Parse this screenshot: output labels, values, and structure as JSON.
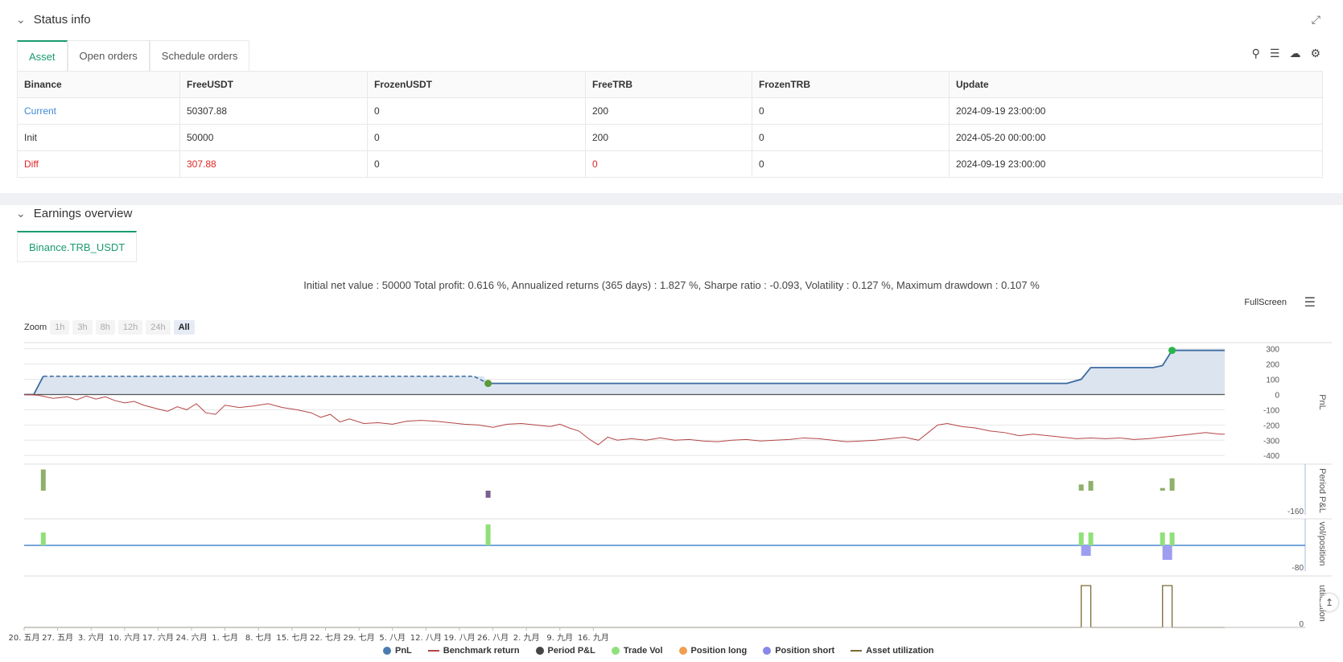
{
  "status": {
    "title": "Status info",
    "tabs": [
      {
        "label": "Asset",
        "active": true
      },
      {
        "label": "Open orders",
        "active": false
      },
      {
        "label": "Schedule orders",
        "active": false
      }
    ],
    "table": {
      "headers": [
        "Binance",
        "FreeUSDT",
        "FrozenUSDT",
        "FreeTRB",
        "FrozenTRB",
        "Update"
      ],
      "rows": [
        [
          "Current",
          "50307.88",
          "0",
          "200",
          "0",
          "2024-09-19 23:00:00"
        ],
        [
          "Init",
          "50000",
          "0",
          "200",
          "0",
          "2024-05-20 00:00:00"
        ],
        [
          "Diff",
          "307.88",
          "0",
          "0",
          "0",
          "2024-09-19 23:00:00"
        ]
      ]
    }
  },
  "earnings": {
    "title": "Earnings overview",
    "tab": "Binance.TRB_USDT",
    "summary": "Initial net value : 50000 Total profit: 0.616 %, Annualized returns (365 days) : 1.827 %, Sharpe ratio : -0.093, Volatility : 0.127 %, Maximum drawdown : 0.107 %",
    "fullscreen_label": "FullScreen",
    "zoom_label": "Zoom",
    "zoom_options": [
      "1h",
      "3h",
      "8h",
      "12h",
      "24h",
      "All"
    ],
    "zoom_selected": "All"
  },
  "chart_data": {
    "type": "line",
    "x_ticks": [
      "20. 五月",
      "27. 五月",
      "3. 六月",
      "10. 六月",
      "17. 六月",
      "24. 六月",
      "1. 七月",
      "8. 七月",
      "15. 七月",
      "22. 七月",
      "29. 七月",
      "5. 八月",
      "12. 八月",
      "19. 八月",
      "26. 八月",
      "2. 九月",
      "9. 九月",
      "16. 九月"
    ],
    "pnl_axis_ticks": [
      "300",
      "200",
      "100",
      "0",
      "-100",
      "-200",
      "-300",
      "-400"
    ],
    "pnl_axis_label": "PnL",
    "period_axis_label": "Period P&L",
    "period_axis_tick": "-160",
    "vol_axis_label": "vol/position",
    "vol_axis_tick": "-80",
    "util_axis_label": "utilization",
    "util_axis_tick": "0",
    "pnl_ylim": [
      -420,
      330
    ],
    "pnl": [
      [
        0,
        0
      ],
      [
        2,
        0
      ],
      [
        4,
        120
      ],
      [
        96,
        120
      ],
      [
        97,
        73
      ],
      [
        218,
        73
      ],
      [
        221,
        100
      ],
      [
        223,
        177
      ],
      [
        236,
        177
      ],
      [
        238,
        190
      ],
      [
        240,
        290
      ],
      [
        250,
        290
      ],
      [
        251,
        290
      ]
    ],
    "pnl_dashed_segment": [
      [
        4,
        120
      ],
      [
        94,
        120
      ],
      [
        97,
        73
      ]
    ],
    "benchmark": [
      [
        0,
        0
      ],
      [
        3,
        -5
      ],
      [
        6,
        -25
      ],
      [
        9,
        -15
      ],
      [
        11,
        -35
      ],
      [
        13,
        -10
      ],
      [
        15,
        -30
      ],
      [
        17,
        -15
      ],
      [
        19,
        -40
      ],
      [
        21,
        -55
      ],
      [
        23,
        -45
      ],
      [
        25,
        -70
      ],
      [
        28,
        -95
      ],
      [
        30,
        -110
      ],
      [
        32,
        -80
      ],
      [
        34,
        -100
      ],
      [
        36,
        -60
      ],
      [
        38,
        -120
      ],
      [
        40,
        -130
      ],
      [
        42,
        -70
      ],
      [
        45,
        -85
      ],
      [
        48,
        -75
      ],
      [
        51,
        -60
      ],
      [
        54,
        -85
      ],
      [
        57,
        -100
      ],
      [
        60,
        -120
      ],
      [
        62,
        -150
      ],
      [
        64,
        -130
      ],
      [
        66,
        -180
      ],
      [
        68,
        -160
      ],
      [
        71,
        -190
      ],
      [
        74,
        -185
      ],
      [
        77,
        -195
      ],
      [
        80,
        -175
      ],
      [
        83,
        -170
      ],
      [
        86,
        -175
      ],
      [
        89,
        -185
      ],
      [
        92,
        -195
      ],
      [
        95,
        -200
      ],
      [
        98,
        -215
      ],
      [
        101,
        -195
      ],
      [
        104,
        -190
      ],
      [
        107,
        -200
      ],
      [
        110,
        -210
      ],
      [
        112,
        -195
      ],
      [
        114,
        -220
      ],
      [
        116,
        -240
      ],
      [
        118,
        -290
      ],
      [
        120,
        -330
      ],
      [
        122,
        -280
      ],
      [
        124,
        -300
      ],
      [
        127,
        -290
      ],
      [
        130,
        -300
      ],
      [
        133,
        -285
      ],
      [
        136,
        -300
      ],
      [
        139,
        -295
      ],
      [
        142,
        -305
      ],
      [
        145,
        -310
      ],
      [
        148,
        -300
      ],
      [
        151,
        -295
      ],
      [
        154,
        -305
      ],
      [
        157,
        -300
      ],
      [
        160,
        -295
      ],
      [
        163,
        -285
      ],
      [
        166,
        -290
      ],
      [
        169,
        -300
      ],
      [
        172,
        -310
      ],
      [
        175,
        -305
      ],
      [
        178,
        -300
      ],
      [
        181,
        -290
      ],
      [
        184,
        -280
      ],
      [
        187,
        -300
      ],
      [
        189,
        -250
      ],
      [
        191,
        -200
      ],
      [
        193,
        -190
      ],
      [
        196,
        -210
      ],
      [
        199,
        -220
      ],
      [
        202,
        -240
      ],
      [
        205,
        -250
      ],
      [
        208,
        -270
      ],
      [
        211,
        -260
      ],
      [
        214,
        -270
      ],
      [
        217,
        -280
      ],
      [
        220,
        -290
      ],
      [
        223,
        -285
      ],
      [
        226,
        -290
      ],
      [
        229,
        -285
      ],
      [
        232,
        -295
      ],
      [
        235,
        -290
      ],
      [
        238,
        -280
      ],
      [
        241,
        -270
      ],
      [
        244,
        -260
      ],
      [
        247,
        -250
      ],
      [
        250,
        -260
      ],
      [
        251,
        -260
      ]
    ],
    "period_pnl": [
      [
        4,
        120,
        "#8fb06a"
      ],
      [
        97,
        -40,
        "#7a5f8f"
      ],
      [
        221,
        35,
        "#8fb06a"
      ],
      [
        223,
        55,
        "#8fb06a"
      ],
      [
        238,
        15,
        "#8fb06a"
      ],
      [
        240,
        70,
        "#8fb06a"
      ]
    ],
    "trade_vol": [
      [
        4,
        1
      ],
      [
        97,
        1
      ],
      [
        221,
        1
      ],
      [
        223,
        1
      ],
      [
        238,
        1
      ],
      [
        240,
        1
      ]
    ],
    "position_short": [
      [
        222,
        1
      ],
      [
        239,
        1
      ]
    ],
    "utilization": [
      [
        0,
        0
      ],
      [
        221,
        0
      ],
      [
        221,
        1
      ],
      [
        223,
        1
      ],
      [
        223,
        0
      ],
      [
        238,
        0
      ],
      [
        238,
        1
      ],
      [
        240,
        1
      ],
      [
        240,
        0
      ],
      [
        251,
        0
      ]
    ],
    "x_range": [
      0,
      251
    ],
    "legend": [
      {
        "name": "PnL",
        "color": "#4a7bb0",
        "kind": "dot"
      },
      {
        "name": "Benchmark return",
        "color": "#b54444",
        "kind": "line"
      },
      {
        "name": "Period P&L",
        "color": "#444444",
        "kind": "dot"
      },
      {
        "name": "Trade Vol",
        "color": "#90e07a",
        "kind": "dot"
      },
      {
        "name": "Position long",
        "color": "#f0a050",
        "kind": "dot"
      },
      {
        "name": "Position short",
        "color": "#8888e8",
        "kind": "dot"
      },
      {
        "name": "Asset utilization",
        "color": "#7a6a30",
        "kind": "line"
      }
    ]
  }
}
